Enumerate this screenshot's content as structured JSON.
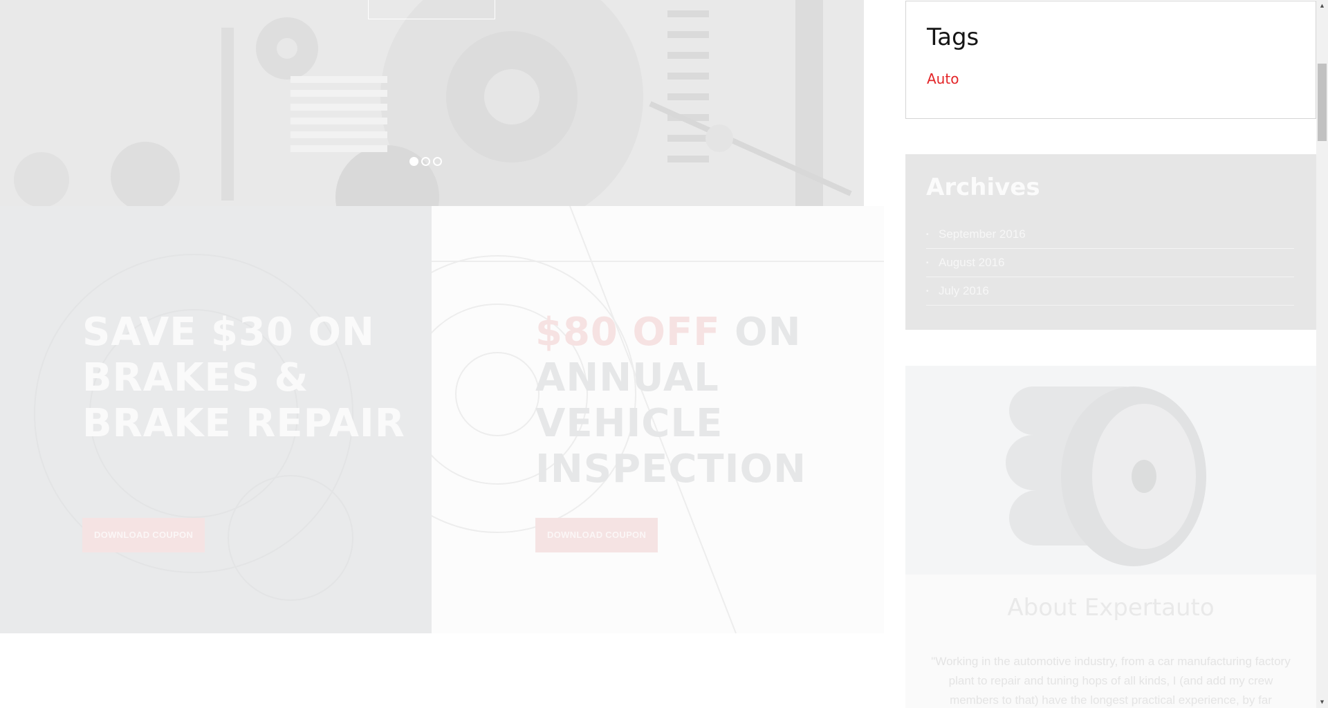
{
  "hero": {
    "slider_dots": [
      {
        "state": "active"
      },
      {
        "state": "inactive"
      },
      {
        "state": "inactive"
      }
    ]
  },
  "coupons": [
    {
      "title": "SAVE $30 ON BRAKES & BRAKE REPAIR",
      "button_label": "DOWNLOAD COUPON"
    },
    {
      "title_accent": "$80 OFF",
      "title_rest": " ON ANNUAL VEHICLE INSPECTION",
      "button_label": "DOWNLOAD COUPON"
    }
  ],
  "sidebar": {
    "tags": {
      "title": "Tags",
      "items": [
        "Auto"
      ]
    },
    "archives": {
      "title": "Archives",
      "items": [
        "September 2016",
        "August 2016",
        "July 2016"
      ]
    },
    "about": {
      "title": "About Expertauto",
      "text": "\"Working in the automotive industry, from a car manufacturing factory plant to repair and tuning hops of all kinds, I (and add my crew members to that) have the longest practical experience, by far"
    }
  },
  "colors": {
    "accent": "#e32326",
    "archive_bg": "#e6e6e6"
  }
}
